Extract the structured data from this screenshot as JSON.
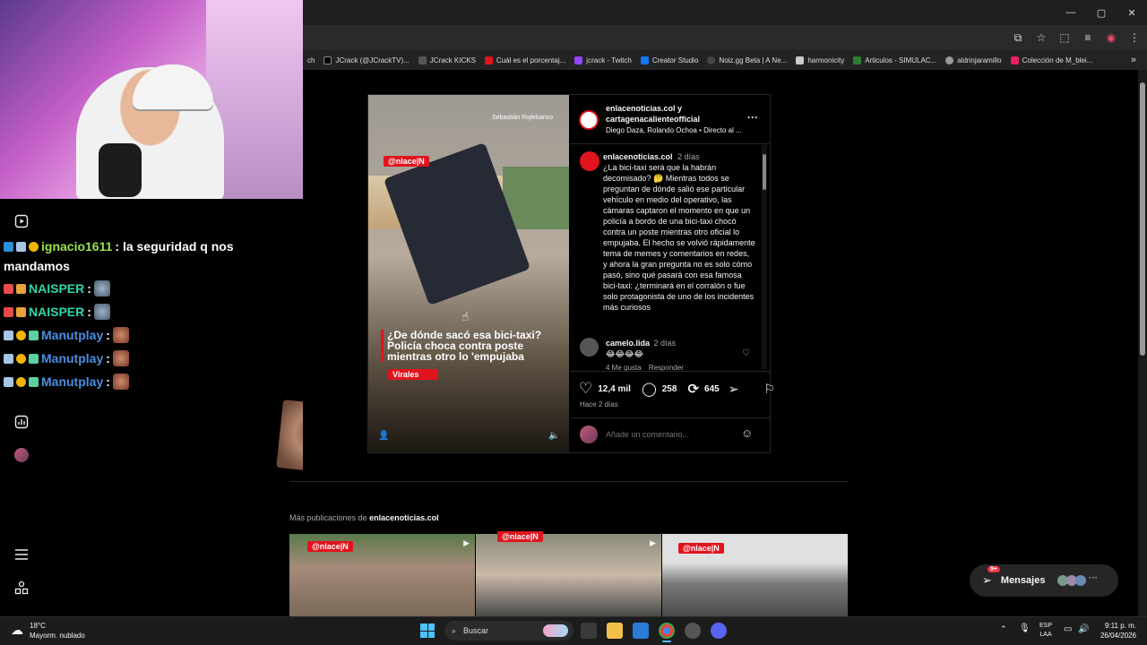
{
  "chrome": {
    "minimize": "—",
    "maximize": "▢",
    "close": "✕",
    "bookmarks": [
      {
        "label": "ch",
        "color": "#333333"
      },
      {
        "label": "JCrack (@JCrackTV)...",
        "color": "#000000"
      },
      {
        "label": "JCrack KICKS",
        "color": "#1a1a1a"
      },
      {
        "label": "Cuál es el porcentaj...",
        "color": "#e0141e"
      },
      {
        "label": "jcrack - Twitch",
        "color": "#9146ff"
      },
      {
        "label": "Creator Studio",
        "color": "#1877f2"
      },
      {
        "label": "Noiz.gg Beta | A Ne...",
        "color": "#444444"
      },
      {
        "label": "harmonicity",
        "color": "#cccccc"
      },
      {
        "label": "Articulos - SIMULAC...",
        "color": "#2e7d32"
      },
      {
        "label": "aldrinjaramillo",
        "color": "#999999"
      },
      {
        "label": "Colección de M_blei...",
        "color": "#e91e63"
      }
    ],
    "bookmarks_more": "»"
  },
  "chat": {
    "messages": [
      {
        "user": "ignacio1611",
        "user_color": "#9ae34d",
        "text": ": la seguridad q nos",
        "text2": "mandamos"
      },
      {
        "user": "NAISPER",
        "user_color": "#2bd6a7",
        "text": ":"
      },
      {
        "user": "NAISPER",
        "user_color": "#2bd6a7",
        "text": ":"
      },
      {
        "user": "Manutplay",
        "user_color": "#4a8fe0",
        "text": ":"
      },
      {
        "user": "Manutplay",
        "user_color": "#4a8fe0",
        "text": ":"
      },
      {
        "user": "Manutplay",
        "user_color": "#4a8fe0",
        "text": ":"
      }
    ]
  },
  "post": {
    "video": {
      "credit": "Sebastián Rojlebanco",
      "logo": "@nlace|N",
      "headline": "¿De dónde sacó esa bici-taxi? Policía choca contra poste mientras otro lo 'empujaba",
      "tag": "Virales"
    },
    "header": {
      "authors": "enlacenoticias.col y cartagenacalienteofficial",
      "subtitle": "Diego Daza, Rolando Ochoa • Directo al ...",
      "more": "···"
    },
    "caption": {
      "user": "enlacenoticias.col",
      "time": "2 días",
      "text": "¿La bici-taxi será que la habrán decomisado? 🤔 Mientras todos se preguntan de dónde salió ese particular vehículo en medio del operativo, las cámaras captaron el momento en que un policía a bordo de una bici-taxi chocó contra un poste mientras otro oficial lo empujaba. El hecho se volvió rápidamente tema de memes y comentarios en redes, y ahora la gran pregunta no es solo cómo pasó, sino qué pasará con esa famosa bici-taxi: ¿terminará en el corralón o fue solo protagonista de uno de los incidentes más curiosos"
    },
    "comment": {
      "user": "camelo.lida",
      "time": "2 días",
      "text": "😂😂😂😂",
      "likes": "4 Me gusta",
      "reply": "Responder"
    },
    "stats": {
      "likes": "12,4 mil",
      "comments": "258",
      "reposts": "645",
      "time": "Hace 2 días"
    },
    "add_comment_placeholder": "Añade un comentario..."
  },
  "more": {
    "prefix": "Más publicaciones de ",
    "account": "enlacenoticias.col",
    "thumb_logo": "@nlace|N"
  },
  "messages": {
    "label": "Mensajes",
    "badge": "9+"
  },
  "taskbar": {
    "temp": "18°C",
    "weather": "Mayorm. nublado",
    "search": "Buscar",
    "lang1": "ESP",
    "lang2": "LAA",
    "time": "9:11 p. m.",
    "date": "26/04/2026"
  },
  "colors": {
    "accent_red": "#e0141e",
    "bg": "#000000"
  }
}
